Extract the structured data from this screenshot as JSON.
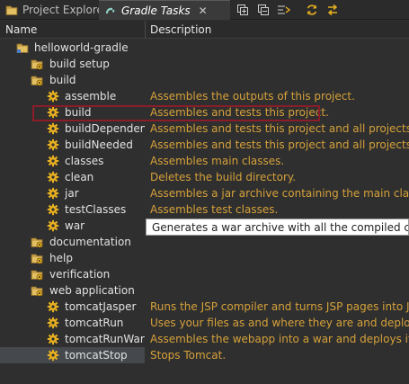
{
  "tabs": [
    {
      "label": "Project Explorer",
      "active": false
    },
    {
      "label": "Gradle Tasks",
      "active": true
    }
  ],
  "tab_close_symbol": "✕",
  "toolbar": [
    "expand-all-icon",
    "collapse-all-icon",
    "link-with-editor-icon",
    "refresh-icon",
    "toggle-icon"
  ],
  "columns": {
    "name": "Name",
    "description": "Description"
  },
  "tree": [
    {
      "level": 0,
      "kind": "project",
      "expander": "down",
      "label": "helloworld-gradle",
      "desc": ""
    },
    {
      "level": 1,
      "kind": "group",
      "expander": "right",
      "label": "build setup",
      "desc": ""
    },
    {
      "level": 1,
      "kind": "group",
      "expander": "down",
      "label": "build",
      "desc": ""
    },
    {
      "level": 2,
      "kind": "task",
      "expander": "",
      "label": "assemble",
      "desc": "Assembles the outputs of this project."
    },
    {
      "level": 2,
      "kind": "task",
      "expander": "",
      "label": "build",
      "desc": "Assembles and tests this project."
    },
    {
      "level": 2,
      "kind": "task",
      "expander": "",
      "label": "buildDependents",
      "desc": "Assembles and tests this project and all projects that depend on it."
    },
    {
      "level": 2,
      "kind": "task",
      "expander": "",
      "label": "buildNeeded",
      "desc": "Assembles and tests this project and all projects it depends on."
    },
    {
      "level": 2,
      "kind": "task",
      "expander": "",
      "label": "classes",
      "desc": "Assembles main classes."
    },
    {
      "level": 2,
      "kind": "task",
      "expander": "",
      "label": "clean",
      "desc": "Deletes the build directory."
    },
    {
      "level": 2,
      "kind": "task",
      "expander": "",
      "label": "jar",
      "desc": "Assembles a jar archive containing the main classes."
    },
    {
      "level": 2,
      "kind": "task",
      "expander": "",
      "label": "testClasses",
      "desc": "Assembles test classes."
    },
    {
      "level": 2,
      "kind": "task",
      "expander": "",
      "label": "war",
      "desc": ""
    },
    {
      "level": 1,
      "kind": "group",
      "expander": "right",
      "label": "documentation",
      "desc": ""
    },
    {
      "level": 1,
      "kind": "group",
      "expander": "right",
      "label": "help",
      "desc": ""
    },
    {
      "level": 1,
      "kind": "group",
      "expander": "right",
      "label": "verification",
      "desc": ""
    },
    {
      "level": 1,
      "kind": "group",
      "expander": "down",
      "label": "web application",
      "desc": ""
    },
    {
      "level": 2,
      "kind": "task",
      "expander": "",
      "label": "tomcatJasper",
      "desc": "Runs the JSP compiler and turns JSP pages into Java source."
    },
    {
      "level": 2,
      "kind": "task",
      "expander": "",
      "label": "tomcatRun",
      "desc": "Uses your files as and where they are and deploys them to Tomcat."
    },
    {
      "level": 2,
      "kind": "task",
      "expander": "",
      "label": "tomcatRunWar",
      "desc": "Assembles the webapp into a war and deploys it to Tomcat."
    },
    {
      "level": 2,
      "kind": "task",
      "expander": "",
      "label": "tomcatStop",
      "desc": "Stops Tomcat.",
      "selected": true
    }
  ],
  "tooltip": "Generates a war archive with all the compiled classes, the web-app content and the libraries.",
  "colors": {
    "description": "#d6a13a",
    "highlight": "#8b1d2a",
    "selection": "#45484c",
    "gear": "#e8b020"
  }
}
